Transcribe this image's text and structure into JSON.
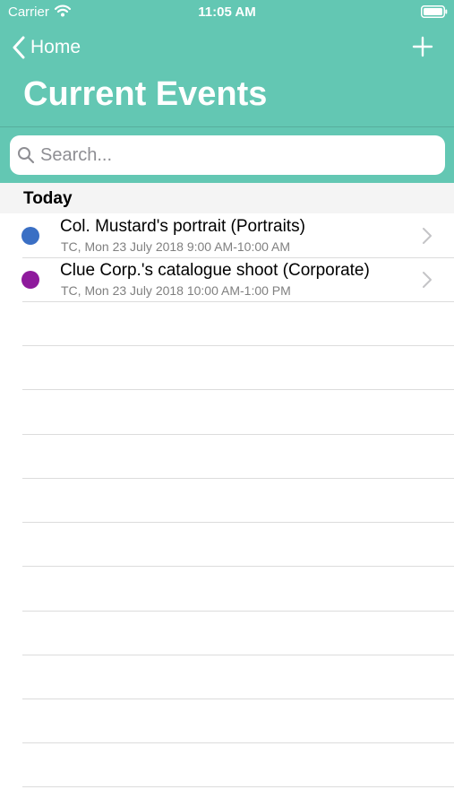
{
  "status_bar": {
    "carrier": "Carrier",
    "time": "11:05 AM"
  },
  "nav": {
    "back_label": "Home",
    "title": "Current Events",
    "search_placeholder": "Search...",
    "accent_color": "#63c7b3"
  },
  "sections": [
    {
      "title": "Today",
      "events": [
        {
          "title": "Col. Mustard's portrait (Portraits)",
          "subtitle": "TC, Mon 23 July 2018 9:00 AM-10:00 AM",
          "color": "#3a6fc4"
        },
        {
          "title": "Clue Corp.'s catalogue shoot (Corporate)",
          "subtitle": "TC, Mon 23 July 2018 10:00 AM-1:00 PM",
          "color": "#8e1a9c"
        }
      ]
    }
  ],
  "icons": {
    "back": "chevron-left-icon",
    "add": "plus-icon",
    "search": "magnifying-glass-icon",
    "disclosure": "chevron-right-icon",
    "wifi": "wifi-icon",
    "battery": "battery-icon"
  }
}
